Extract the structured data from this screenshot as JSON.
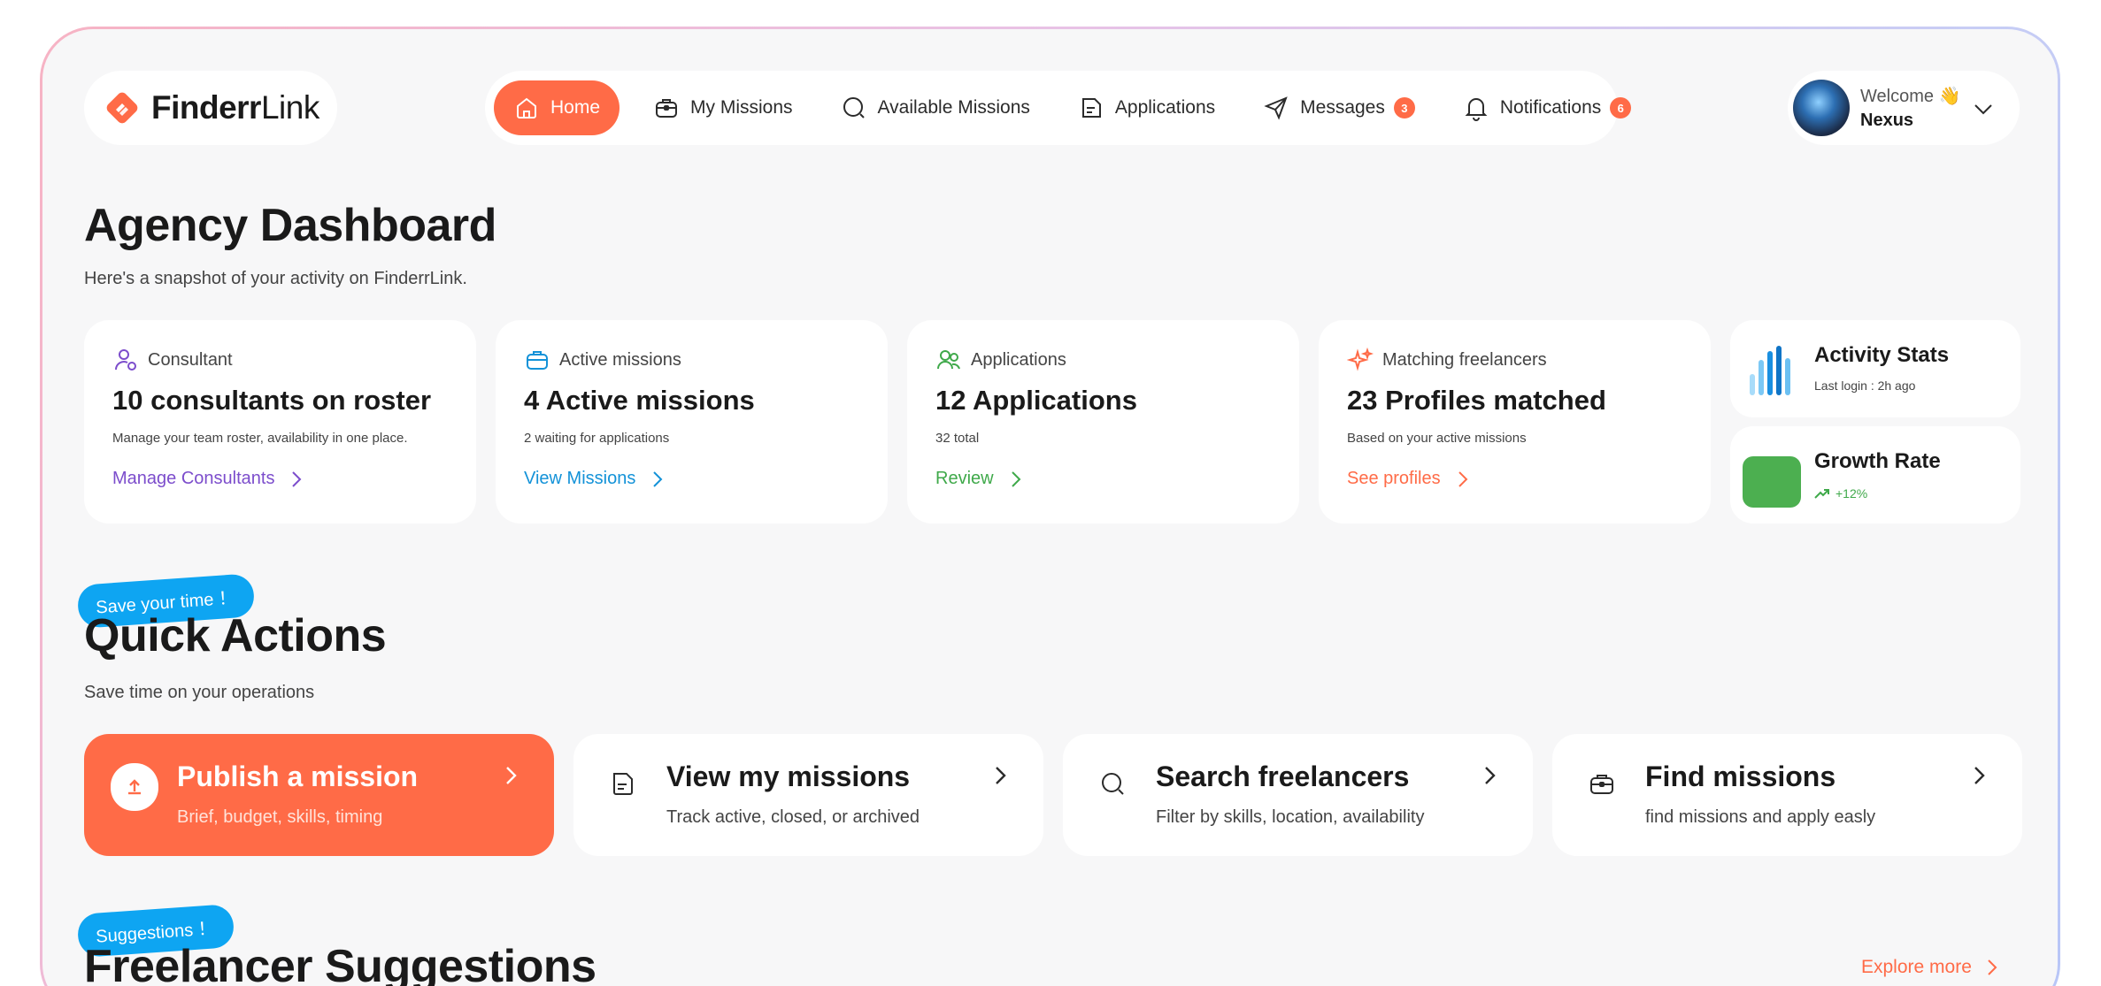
{
  "brand": {
    "name_bold": "Finderr",
    "name_light": "Link",
    "accent": "#ff6b47"
  },
  "nav": [
    {
      "label": "Home",
      "icon": "home-icon",
      "active": true
    },
    {
      "label": "My Missions",
      "icon": "briefcase-icon"
    },
    {
      "label": "Available Missions",
      "icon": "search-icon"
    },
    {
      "label": "Applications",
      "icon": "document-icon"
    },
    {
      "label": "Messages",
      "icon": "send-icon",
      "badge": "3"
    },
    {
      "label": "Notifications",
      "icon": "bell-icon",
      "badge": "6"
    }
  ],
  "user": {
    "greeting": "Welcome 👋",
    "name": "Nexus"
  },
  "header": {
    "title": "Agency Dashboard",
    "subtitle": "Here's a snapshot of your activity on FinderrLink."
  },
  "stats": [
    {
      "label": "Consultant",
      "value": "10 consultants on roster",
      "note": "Manage your team roster, availability in one place.",
      "link": "Manage Consultants",
      "color": "#7c4dcc"
    },
    {
      "label": "Active missions",
      "value": "4 Active missions",
      "note": "2 waiting for applications",
      "link": "View Missions",
      "color": "#1392d8"
    },
    {
      "label": "Applications",
      "value": "12 Applications",
      "note": "32 total",
      "link": "Review",
      "color": "#3fa94a"
    },
    {
      "label": "Matching freelancers",
      "value": "23 Profiles matched",
      "note": "Based on your active missions",
      "link": "See profiles",
      "color": "#ff6b47"
    }
  ],
  "side": {
    "activity": {
      "title": "Activity Stats",
      "sub": "Last login : 2h ago"
    },
    "growth": {
      "title": "Growth Rate",
      "sub": "+12%",
      "color": "#4caf50"
    }
  },
  "quick": {
    "tag": "Save your time ！",
    "title": "Quick Actions",
    "subtitle": "Save time on your operations",
    "cards": [
      {
        "title": "Publish a mission",
        "sub": "Brief, budget, skills, timing"
      },
      {
        "title": "View my missions",
        "sub": "Track active, closed, or archived"
      },
      {
        "title": "Search freelancers",
        "sub": "Filter by skills, location, availability"
      },
      {
        "title": "Find missions",
        "sub": "find missions and apply easly"
      }
    ]
  },
  "suggestions": {
    "tag": "Suggestions ！",
    "title": "Freelancer Suggestions",
    "link": "Explore more"
  }
}
